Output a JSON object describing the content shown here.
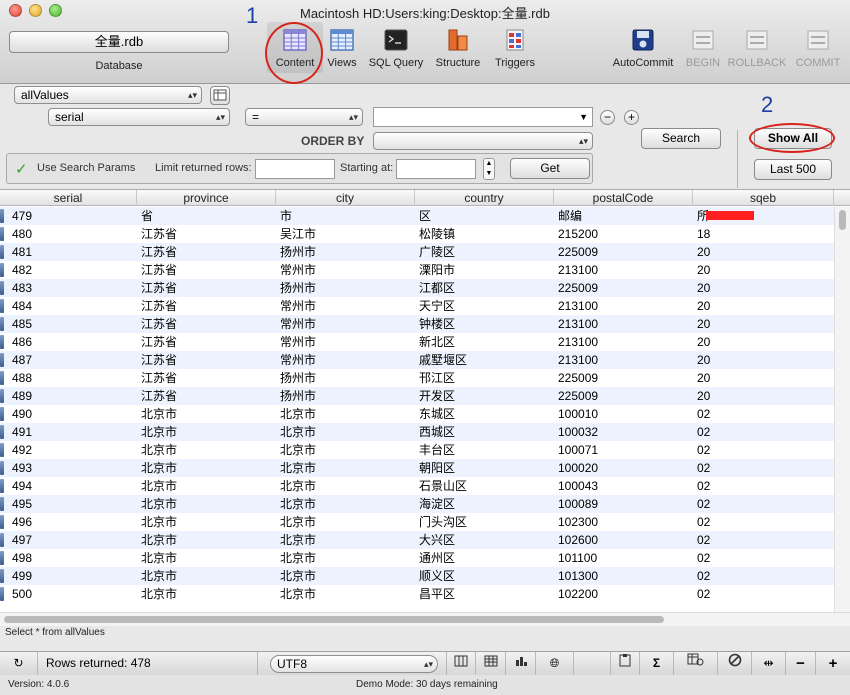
{
  "window": {
    "title": "Macintosh HD:Users:king:Desktop:全量.rdb"
  },
  "database": {
    "button": "全量.rdb",
    "label": "Database"
  },
  "toolbar": {
    "content": "Content",
    "views": "Views",
    "sql_query": "SQL Query",
    "structure": "Structure",
    "triggers": "Triggers",
    "autocommit": "AutoCommit",
    "begin": "BEGIN",
    "rollback": "ROLLBACK",
    "commit": "COMMIT"
  },
  "annotations": {
    "one": "1",
    "two": "2",
    "circle_color": "#d8231c",
    "number_color": "#1c3ea6"
  },
  "filter": {
    "table_select": "allValues",
    "column_select": "serial",
    "operator_select": "=",
    "value": "",
    "order_by_label": "ORDER BY",
    "order_by_select": "",
    "search_button": "Search",
    "show_all_button": "Show All",
    "last500_button": "Last 500",
    "use_search_params": "Use Search Params",
    "limit_label": "Limit returned rows:",
    "limit_value": "",
    "starting_label": "Starting at:",
    "starting_value": "",
    "get_button": "Get",
    "minus": "−",
    "plus": "+"
  },
  "table": {
    "columns": [
      "serial",
      "province",
      "city",
      "country",
      "postalCode",
      "sqeb"
    ],
    "rows": [
      [
        "479",
        "省",
        "市",
        "区",
        "邮编",
        "所"
      ],
      [
        "480",
        "江苏省",
        "吴江市",
        "松陵镇",
        "215200",
        "18"
      ],
      [
        "481",
        "江苏省",
        "扬州市",
        "广陵区",
        "225009",
        "20"
      ],
      [
        "482",
        "江苏省",
        "常州市",
        "溧阳市",
        "213100",
        "20"
      ],
      [
        "483",
        "江苏省",
        "扬州市",
        "江都区",
        "225009",
        "20"
      ],
      [
        "484",
        "江苏省",
        "常州市",
        "天宁区",
        "213100",
        "20"
      ],
      [
        "485",
        "江苏省",
        "常州市",
        "钟楼区",
        "213100",
        "20"
      ],
      [
        "486",
        "江苏省",
        "常州市",
        "新北区",
        "213100",
        "20"
      ],
      [
        "487",
        "江苏省",
        "常州市",
        "戚墅堰区",
        "213100",
        "20"
      ],
      [
        "488",
        "江苏省",
        "扬州市",
        "邗江区",
        "225009",
        "20"
      ],
      [
        "489",
        "江苏省",
        "扬州市",
        "开发区",
        "225009",
        "20"
      ],
      [
        "490",
        "北京市",
        "北京市",
        "东城区",
        "100010",
        "02"
      ],
      [
        "491",
        "北京市",
        "北京市",
        "西城区",
        "100032",
        "02"
      ],
      [
        "492",
        "北京市",
        "北京市",
        "丰台区",
        "100071",
        "02"
      ],
      [
        "493",
        "北京市",
        "北京市",
        "朝阳区",
        "100020",
        "02"
      ],
      [
        "494",
        "北京市",
        "北京市",
        "石景山区",
        "100043",
        "02"
      ],
      [
        "495",
        "北京市",
        "北京市",
        "海淀区",
        "100089",
        "02"
      ],
      [
        "496",
        "北京市",
        "北京市",
        "门头沟区",
        "102300",
        "02"
      ],
      [
        "497",
        "北京市",
        "北京市",
        "大兴区",
        "102600",
        "02"
      ],
      [
        "498",
        "北京市",
        "北京市",
        "通州区",
        "101100",
        "02"
      ],
      [
        "499",
        "北京市",
        "北京市",
        "顺义区",
        "101300",
        "02"
      ],
      [
        "500",
        "北京市",
        "北京市",
        "昌平区",
        "102200",
        "02"
      ]
    ]
  },
  "query": "Select * from allValues",
  "bottom": {
    "rows_returned": "Rows returned: 478",
    "encoding": "UTF8",
    "sigma": "Σ",
    "minus": "−",
    "plus": "+"
  },
  "status": {
    "version": "Version: 4.0.6",
    "demo": "Demo Mode: 30 days remaining"
  }
}
